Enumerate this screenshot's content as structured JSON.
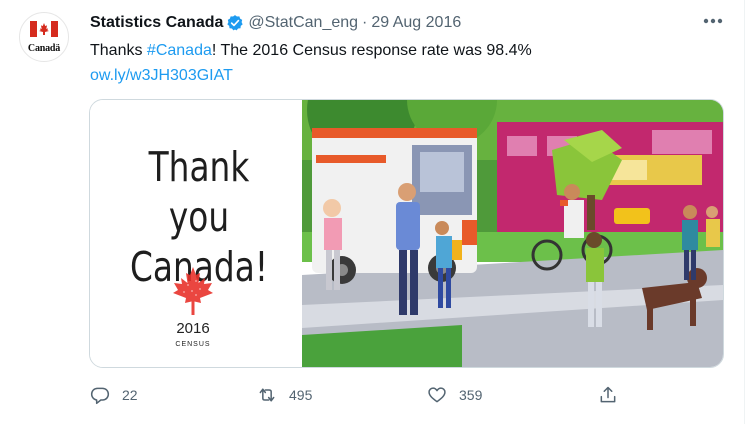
{
  "tweet": {
    "author_name": "Statistics Canada",
    "handle": "@StatCan_eng",
    "separator": "·",
    "date": "29 Aug 2016",
    "avatar_wordmark": "Canadä",
    "text_before": "Thanks ",
    "hashtag": "#Canada",
    "text_after": "! The 2016  Census response rate was 98.4%",
    "link": "ow.ly/w3JH303GIAT"
  },
  "media": {
    "headline_line1": "Thank you",
    "headline_line2": "Canada!",
    "census_year": "2016",
    "census_label": "CENSUS"
  },
  "actions": {
    "replies": "22",
    "retweets": "495",
    "likes": "359"
  },
  "icons": {
    "verified": "verified-badge-icon",
    "more": "more-options-icon",
    "reply": "reply-icon",
    "retweet": "retweet-icon",
    "like": "heart-icon",
    "share": "share-icon"
  },
  "colors": {
    "link": "#1d9bf0",
    "text": "#0f1419",
    "secondary": "#536471",
    "flag_red": "#d52b1e"
  }
}
